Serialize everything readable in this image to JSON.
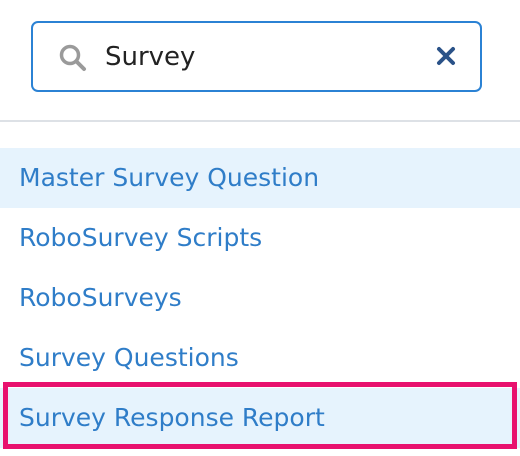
{
  "search": {
    "value": "Survey",
    "icon": "search-icon",
    "clear_icon": "close-icon"
  },
  "colors": {
    "accent_border": "#2b82d4",
    "link_text": "#2f7dc8",
    "row_highlight": "#e6f3fd",
    "selection_outline": "#e8116e",
    "clear_icon": "#2a5288",
    "search_icon": "#9a9a9a"
  },
  "results": [
    {
      "label": "Master Survey Question",
      "highlighted": true
    },
    {
      "label": "RoboSurvey Scripts",
      "highlighted": false
    },
    {
      "label": "RoboSurveys",
      "highlighted": false
    },
    {
      "label": "Survey Questions",
      "highlighted": false
    },
    {
      "label": "Survey Response Report",
      "highlighted": false,
      "selected": true
    }
  ]
}
